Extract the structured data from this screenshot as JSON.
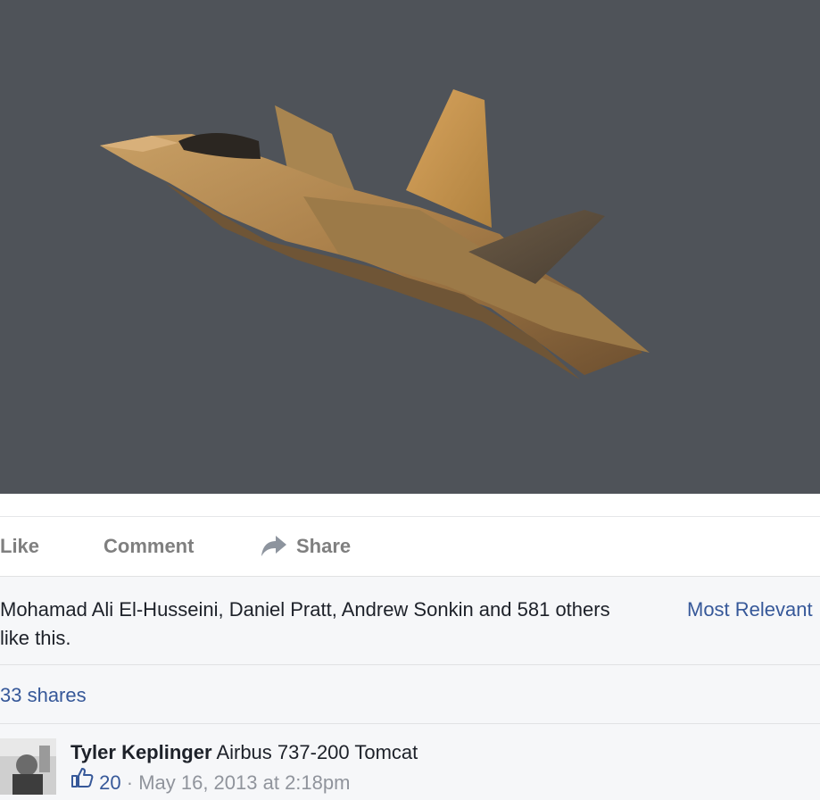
{
  "post": {
    "photo_icon": "fighter-jet-photo"
  },
  "actions": {
    "like_label": "Like",
    "comment_label": "Comment",
    "share_label": "Share",
    "share_icon": "share-arrow-icon"
  },
  "feedback": {
    "likes_text": "Mohamad Ali El-Husseini, Daniel Pratt, Andrew Sonkin and 581 others like this.",
    "sort_label": "Most Relevant",
    "shares_label": "33 shares"
  },
  "comment": {
    "author": "Tyler Keplinger",
    "text": "Airbus 737-200 Tomcat",
    "like_count": "20",
    "separator": "·",
    "timestamp": "May 16, 2013 at 2:18pm"
  },
  "colors": {
    "link": "#365899",
    "text": "#1d2129",
    "muted": "#90949c",
    "action": "#7f7f7f",
    "photo_bg": "#4f5359",
    "feedback_bg": "#f6f7f9"
  }
}
